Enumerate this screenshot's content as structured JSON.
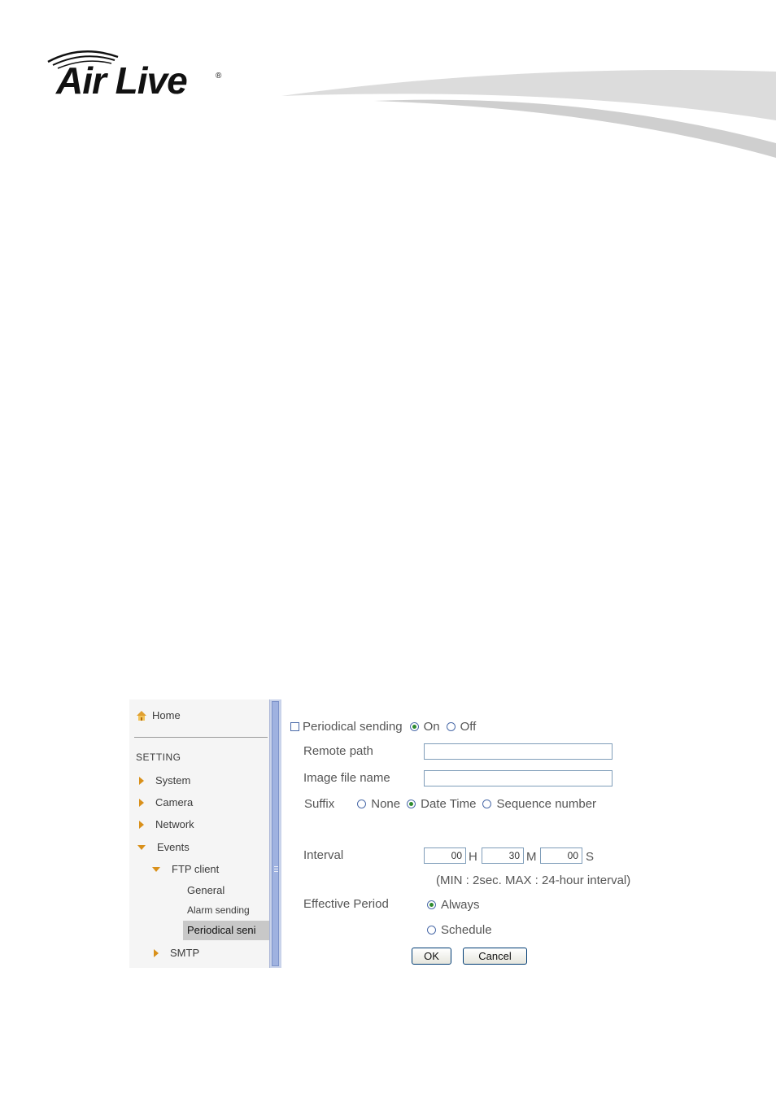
{
  "header": {
    "brand": "Air Live",
    "registered_mark": "®"
  },
  "sidebar": {
    "home_label": "Home",
    "section_label": "SETTING",
    "items": [
      {
        "label": "System"
      },
      {
        "label": "Camera"
      },
      {
        "label": "Network"
      },
      {
        "label": "Events"
      }
    ],
    "ftp_client_label": "FTP client",
    "ftp_children": [
      {
        "label": "General"
      },
      {
        "label": "Alarm sending"
      },
      {
        "label": "Periodical seni"
      }
    ],
    "smtp_label": "SMTP"
  },
  "form": {
    "periodical_sending_label": "Periodical sending",
    "on_label": "On",
    "off_label": "Off",
    "periodical_sending_value": "On",
    "remote_path_label": "Remote path",
    "remote_path_value": "",
    "image_file_name_label": "Image file name",
    "image_file_name_value": "",
    "suffix_label": "Suffix",
    "suffix_options": [
      "None",
      "Date Time",
      "Sequence number"
    ],
    "suffix_value": "Date Time",
    "interval_label": "Interval",
    "interval_hours": "00",
    "interval_minutes": "30",
    "interval_seconds": "00",
    "unit_h": "H",
    "unit_m": "M",
    "unit_s": "S",
    "interval_note": "(MIN : 2sec. MAX : 24-hour interval)",
    "effective_period_label": "Effective Period",
    "always_label": "Always",
    "schedule_label": "Schedule",
    "effective_period_value": "Always",
    "ok_label": "OK",
    "cancel_label": "Cancel"
  },
  "colors": {
    "accent_orange": "#d9901a",
    "radio_dot": "#2e8b2e",
    "input_border": "#7f9db9"
  }
}
